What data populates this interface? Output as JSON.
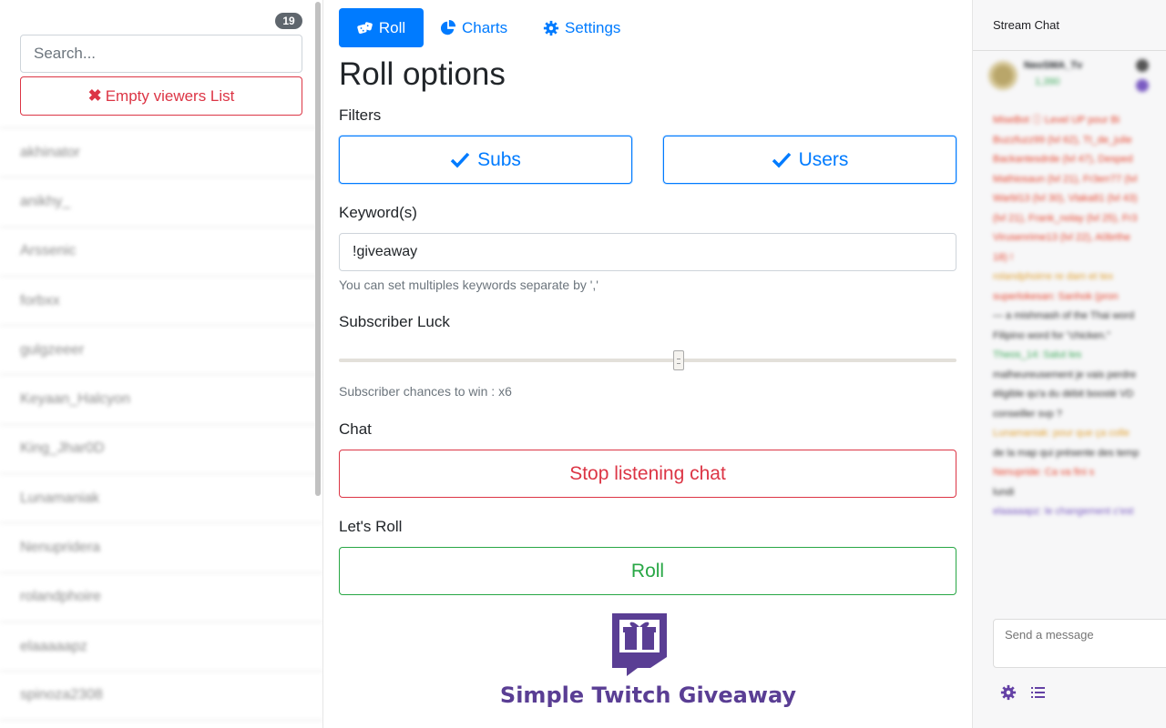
{
  "viewers": {
    "count": "19",
    "search_placeholder": "Search...",
    "empty_label": "Empty viewers List",
    "items": [
      "akhinator",
      "anikhy_",
      "Arssenic",
      "forbxx",
      "gulgzeeer",
      "Keyaan_Halcyon",
      "King_Jhar0D",
      "Lunamaniak",
      "Nenupridera",
      "rolandphoire",
      "elaaaaapz",
      "spinoza2308"
    ]
  },
  "nav": {
    "tabs": [
      {
        "label": "Roll",
        "icon": "dice-icon",
        "active": true
      },
      {
        "label": "Charts",
        "icon": "pie-chart-icon",
        "active": false
      },
      {
        "label": "Settings",
        "icon": "gear-icon",
        "active": false
      }
    ]
  },
  "roll": {
    "title": "Roll options",
    "filters_label": "Filters",
    "subs_label": "Subs",
    "users_label": "Users",
    "keyword_label": "Keyword(s)",
    "keyword_value": "!giveaway",
    "keyword_help": "You can set multiples keywords separate by ','",
    "luck_label": "Subscriber Luck",
    "luck_value": 0.55,
    "luck_help": "Subscriber chances to win : x6",
    "chat_label": "Chat",
    "stop_label": "Stop listening chat",
    "lets_roll_label": "Let's Roll",
    "roll_label": "Roll"
  },
  "brand": {
    "name": "Simple Twitch Giveaway",
    "color": "#5a3e94"
  },
  "chat": {
    "title": "Stream Chat",
    "top_chatter": {
      "name": "NeoSMA_Tv",
      "points": "1,390"
    },
    "lines": [
      {
        "cls": "red",
        "text": "MiseBot ⓘ Level UP pour Bi"
      },
      {
        "cls": "red",
        "text": "Buzzfuzz99 (lvl 62), Tt_de_julie"
      },
      {
        "cls": "red",
        "text": "Backantesdrde (lvl 47), Desped"
      },
      {
        "cls": "red",
        "text": "Mathiosaun (lvl 21), Fr3err77 (lvl"
      },
      {
        "cls": "red",
        "text": "Warbl13 (lvl 30), Vlaka81 (lvl 43)"
      },
      {
        "cls": "red",
        "text": "(lvl 21), Frank_nolay (lvl 25), Fr3"
      },
      {
        "cls": "red",
        "text": "Virusenrime13 (lvl 22), A0brthe"
      },
      {
        "cls": "red",
        "text": "18) !"
      },
      {
        "cls": "",
        "text": " "
      },
      {
        "cls": "orange",
        "text": "rolandphoirre re dam et tex"
      },
      {
        "cls": "",
        "text": " "
      },
      {
        "cls": "red",
        "text": "superlokesan: Sanhok (pron"
      },
      {
        "cls": "",
        "text": "— a mishmash of the Thai word"
      },
      {
        "cls": "",
        "text": "Filipino word for \"chicken.\""
      },
      {
        "cls": "",
        "text": " "
      },
      {
        "cls": "green",
        "text": "Theos_14: Salut les"
      },
      {
        "cls": "",
        "text": "malheureusement je vais perdre"
      },
      {
        "cls": "",
        "text": "éligible qu'a du débit boostè VD"
      },
      {
        "cls": "",
        "text": "conseiller svp ?"
      },
      {
        "cls": "",
        "text": " "
      },
      {
        "cls": "orange",
        "text": "Lunamaniak: pour que ça colle"
      },
      {
        "cls": "",
        "text": "de la map qui présente des temp"
      },
      {
        "cls": "",
        "text": " "
      },
      {
        "cls": "red",
        "text": "Nenupride: Ca va fini s"
      },
      {
        "cls": "",
        "text": "lundi"
      },
      {
        "cls": "",
        "text": " "
      },
      {
        "cls": "purple",
        "text": "elaaaaapz: le changement c'est"
      }
    ],
    "input_placeholder": "Send a message"
  }
}
